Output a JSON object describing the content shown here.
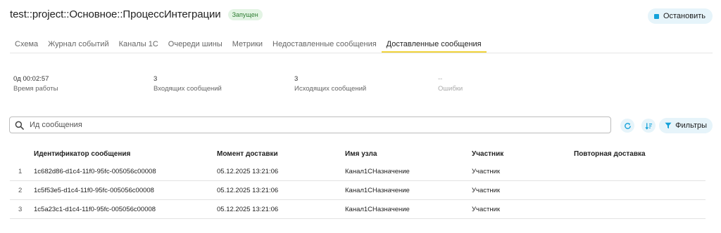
{
  "header": {
    "title": "test::project::Основное::ПроцессИнтеграции",
    "status": "Запущен",
    "stop_label": "Остановить"
  },
  "tabs": [
    {
      "label": "Схема"
    },
    {
      "label": "Журнал событий"
    },
    {
      "label": "Каналы 1С"
    },
    {
      "label": "Очереди шины"
    },
    {
      "label": "Метрики"
    },
    {
      "label": "Недоставленные сообщения"
    },
    {
      "label": "Доставленные сообщения",
      "active": true
    }
  ],
  "stats": [
    {
      "value": "0д 00:02:57",
      "label": "Время работы"
    },
    {
      "value": "3",
      "label": "Входящих сообщений"
    },
    {
      "value": "3",
      "label": "Исходящих сообщений"
    },
    {
      "value": "--",
      "label": "Ошибки"
    }
  ],
  "search": {
    "placeholder": "Ид сообщения",
    "value": ""
  },
  "toolbar": {
    "filters_label": "Фильтры",
    "refresh_icon": "refresh-icon",
    "sort_icon": "sort-icon"
  },
  "table": {
    "columns": [
      "Идентификатор сообщения",
      "Момент доставки",
      "Имя узла",
      "Участник",
      "Повторная доставка"
    ],
    "rows": [
      {
        "n": "1",
        "id": "1c682d86-d1c4-11f0-95fc-005056c00008",
        "time": "05.12.2025 13:21:06",
        "node": "Канал1СНазначение",
        "member": "Участник",
        "redeliver": ""
      },
      {
        "n": "2",
        "id": "1c5f53e5-d1c4-11f0-95fc-005056c00008",
        "time": "05.12.2025 13:21:06",
        "node": "Канал1СНазначение",
        "member": "Участник",
        "redeliver": ""
      },
      {
        "n": "3",
        "id": "1c5a23c1-d1c4-11f0-95fc-005056c00008",
        "time": "05.12.2025 13:21:06",
        "node": "Канал1СНазначение",
        "member": "Участник",
        "redeliver": ""
      }
    ]
  },
  "colors": {
    "accent": "#14a1d9",
    "tab_underline": "#f0d33a",
    "button_bg": "#e6f4fa",
    "status_bg": "#e3f4e4",
    "status_text": "#2e7d32"
  }
}
